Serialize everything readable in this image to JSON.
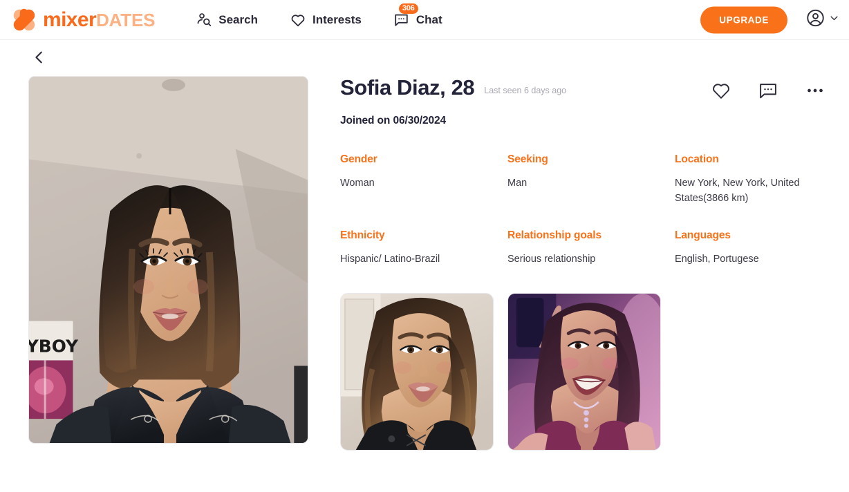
{
  "brand": {
    "name_part1": "mixer",
    "name_part2": "DATES",
    "logo_icon": "x-heart-logo-icon",
    "accent": "#f9721a",
    "accent_light": "#fcb183"
  },
  "header": {
    "nav": [
      {
        "label": "Search",
        "icon": "person-search-icon",
        "badge": null
      },
      {
        "label": "Interests",
        "icon": "heart-icon",
        "badge": null
      },
      {
        "label": "Chat",
        "icon": "chat-bubble-icon",
        "badge": "306"
      }
    ],
    "upgrade_label": "UPGRADE",
    "account_icon": "account-circle-icon",
    "account_chevron_icon": "chevron-down-icon"
  },
  "back": {
    "icon": "chevron-left-icon",
    "label": "Back"
  },
  "profile": {
    "name": "Sofia Diaz, 28",
    "last_seen": "Last seen 6 days ago",
    "joined": "Joined on 06/30/2024",
    "actions": [
      {
        "name": "like-button",
        "icon": "heart-icon"
      },
      {
        "name": "message-button",
        "icon": "chat-bubble-icon"
      },
      {
        "name": "more-button",
        "icon": "more-horizontal-icon"
      }
    ],
    "facts": [
      {
        "label": "Gender",
        "value": "Woman"
      },
      {
        "label": "Seeking",
        "value": "Man"
      },
      {
        "label": "Location",
        "value": "New York, New York, United States(3866 km)"
      },
      {
        "label": "Ethnicity",
        "value": "Hispanic/ Latino-Brazil"
      },
      {
        "label": "Relationship goals",
        "value": "Serious relationship"
      },
      {
        "label": "Languages",
        "value": "English, Portugese"
      }
    ],
    "main_photo_alt": "Profile photo of Sofia Diaz, selfie in black top",
    "thumbnails": [
      {
        "alt": "Sofia Diaz photo 2, indoor selfie in black top"
      },
      {
        "alt": "Sofia Diaz photo 3, night selfie with purple lighting"
      }
    ]
  }
}
